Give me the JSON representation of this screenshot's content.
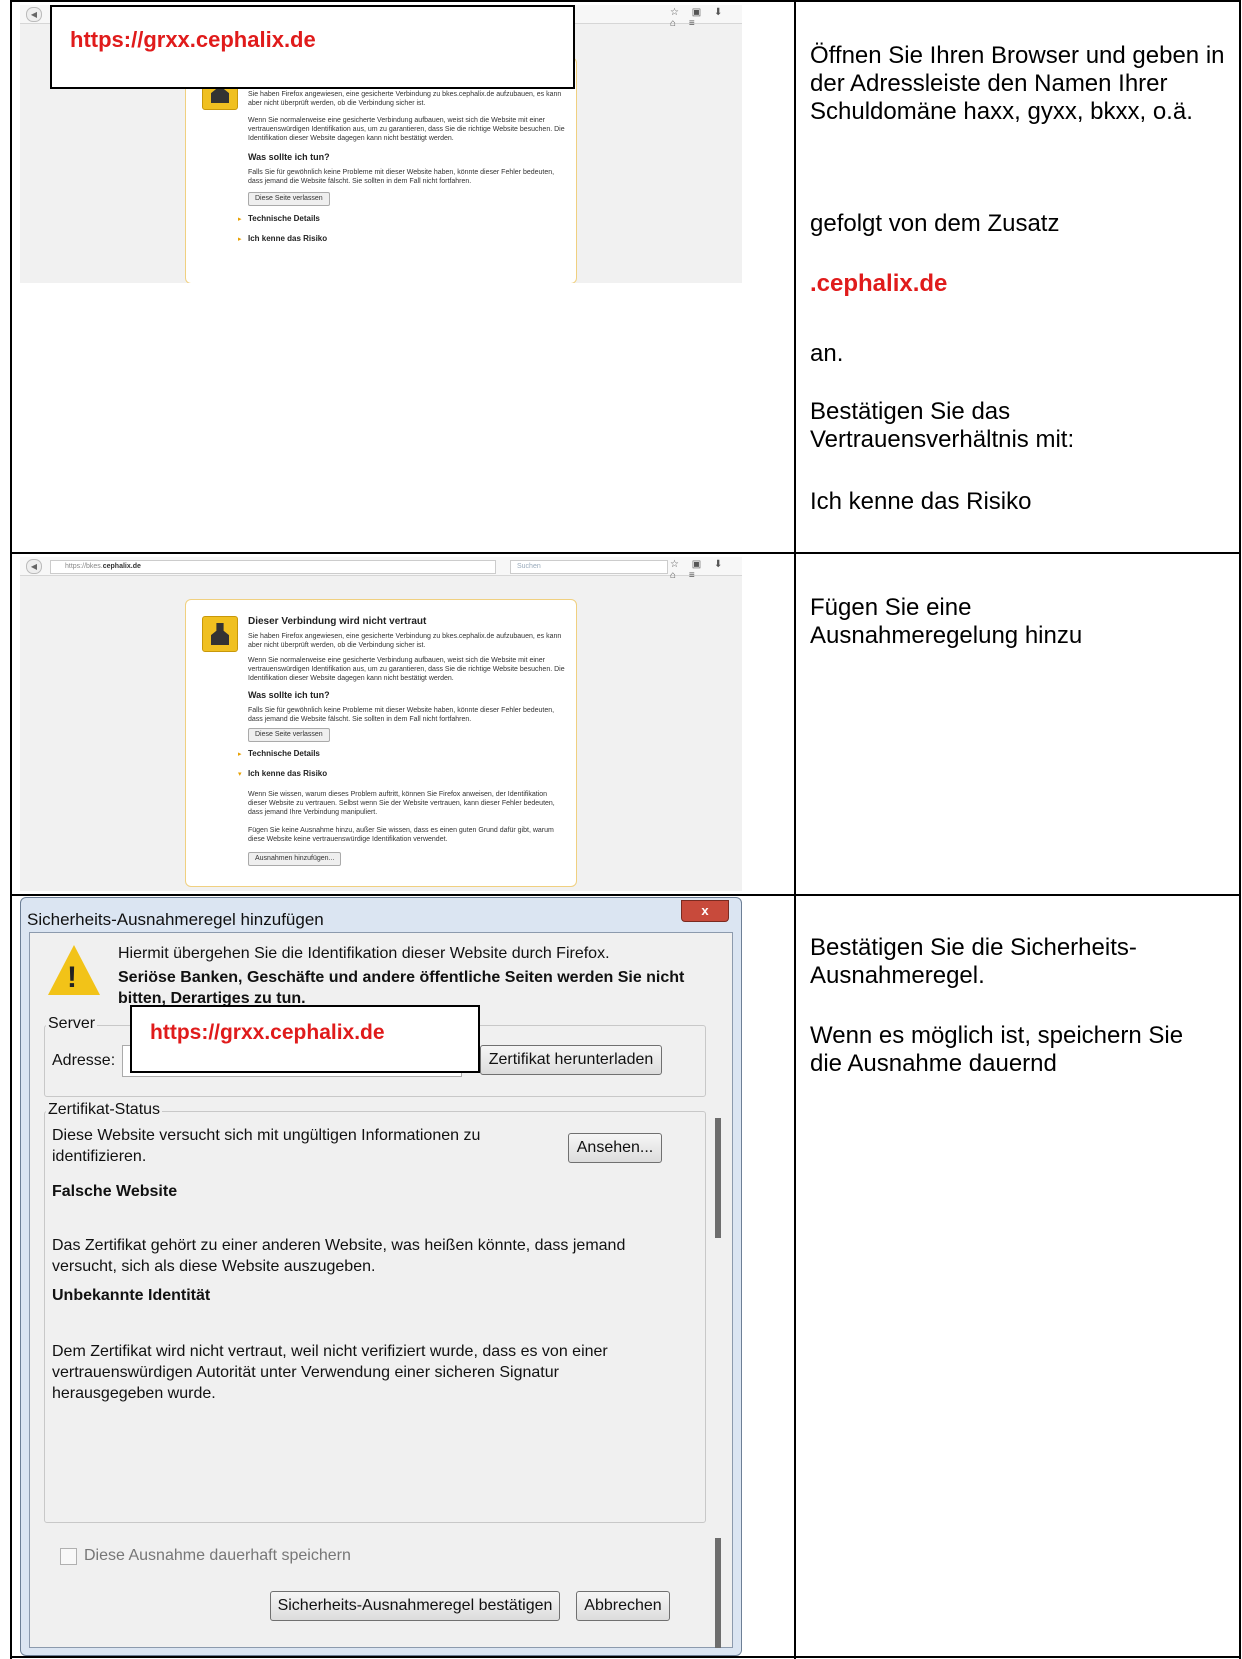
{
  "row1": {
    "overlay_url": "https://grxx.cephalix.de",
    "instructions": {
      "p1": "Öffnen Sie Ihren Browser und geben in der Adressleiste den Namen Ihrer Schuldomäne haxx, gyxx, bkxx, o.ä.",
      "p2": "gefolgt von dem Zusatz",
      "p3": ".cephalix.de",
      "p4": "an.",
      "p5": "Bestätigen Sie das Vertrauensverhältnis mit:",
      "p6": "Ich kenne das Risiko"
    }
  },
  "browser": {
    "url_prefix": "https://bkes.",
    "url_domain": "cephalix.de",
    "search_placeholder": "Suchen",
    "nav_icons": "☆ ▣ ⬇ ⌂ ≡",
    "error_title": "Dieser Verbindung wird nicht vertraut",
    "error_p1": "Sie haben Firefox angewiesen, eine gesicherte Verbindung zu bkes.cephalix.de aufzubauen, es kann aber nicht überprüft werden, ob die Verbindung sicher ist.",
    "error_p2": "Wenn Sie normalerweise eine gesicherte Verbindung aufbauen, weist sich die Website mit einer vertrauenswürdigen Identifikation aus, um zu garantieren, dass Sie die richtige Website besuchen. Die Identifikation dieser Website dagegen kann nicht bestätigt werden.",
    "what_title": "Was sollte ich tun?",
    "what_p": "Falls Sie für gewöhnlich keine Probleme mit dieser Website haben, könnte dieser Fehler bedeuten, dass jemand die Website fälscht. Sie sollten in dem Fall nicht fortfahren.",
    "leave_button": "Diese Seite verlassen",
    "tech_details": "Technische Details",
    "risk_label": "Ich kenne das Risiko",
    "risk_p1": "Wenn Sie wissen, warum dieses Problem auftritt, können Sie Firefox anweisen, der Identifikation dieser Website zu vertrauen. Selbst wenn Sie der Website vertrauen, kann dieser Fehler bedeuten, dass jemand Ihre Verbindung manipuliert.",
    "risk_p2": "Fügen Sie keine Ausnahme hinzu, außer Sie wissen, dass es einen guten Grund dafür gibt, warum diese Website keine vertrauenswürdige Identifikation verwendet.",
    "add_exception_button": "Ausnahmen hinzufügen..."
  },
  "row2": {
    "instruction": "Fügen Sie eine Ausnahmeregelung hinzu"
  },
  "dialog": {
    "title": "Sicherheits-Ausnahmeregel hinzufügen",
    "close": "x",
    "intro": "Hiermit übergehen Sie die Identifikation dieser Website durch Firefox.",
    "warning": "Seriöse Banken, Geschäfte und andere öffentliche Seiten werden Sie nicht bitten, Derartiges zu tun.",
    "server_group": "Server",
    "address_label": "Adresse:",
    "address_value": "https://grxx.cephalix.de",
    "download_button": "Zertifikat herunterladen",
    "status_group": "Zertifikat-Status",
    "status_text": "Diese Website versucht sich mit ungültigen Informationen zu identifizieren.",
    "view_button": "Ansehen...",
    "wrong_title": "Falsche Website",
    "wrong_text": "Das Zertifikat gehört zu einer anderen Website, was heißen könnte, dass jemand versucht, sich als diese Website auszugeben.",
    "unknown_title": "Unbekannte Identität",
    "unknown_text": "Dem Zertifikat wird nicht vertraut, weil nicht verifiziert wurde, dass es von einer vertrauenswürdigen Autorität unter Verwendung einer sicheren Signatur herausgegeben wurde.",
    "permanent_checkbox": "Diese Ausnahme dauerhaft speichern",
    "confirm_button": "Sicherheits-Ausnahmeregel bestätigen",
    "cancel_button": "Abbrechen"
  },
  "row3": {
    "p1": "Bestätigen Sie die Sicherheits-Ausnahmeregel.",
    "p2": "Wenn es möglich ist, speichern Sie die Ausnahme dauernd"
  }
}
